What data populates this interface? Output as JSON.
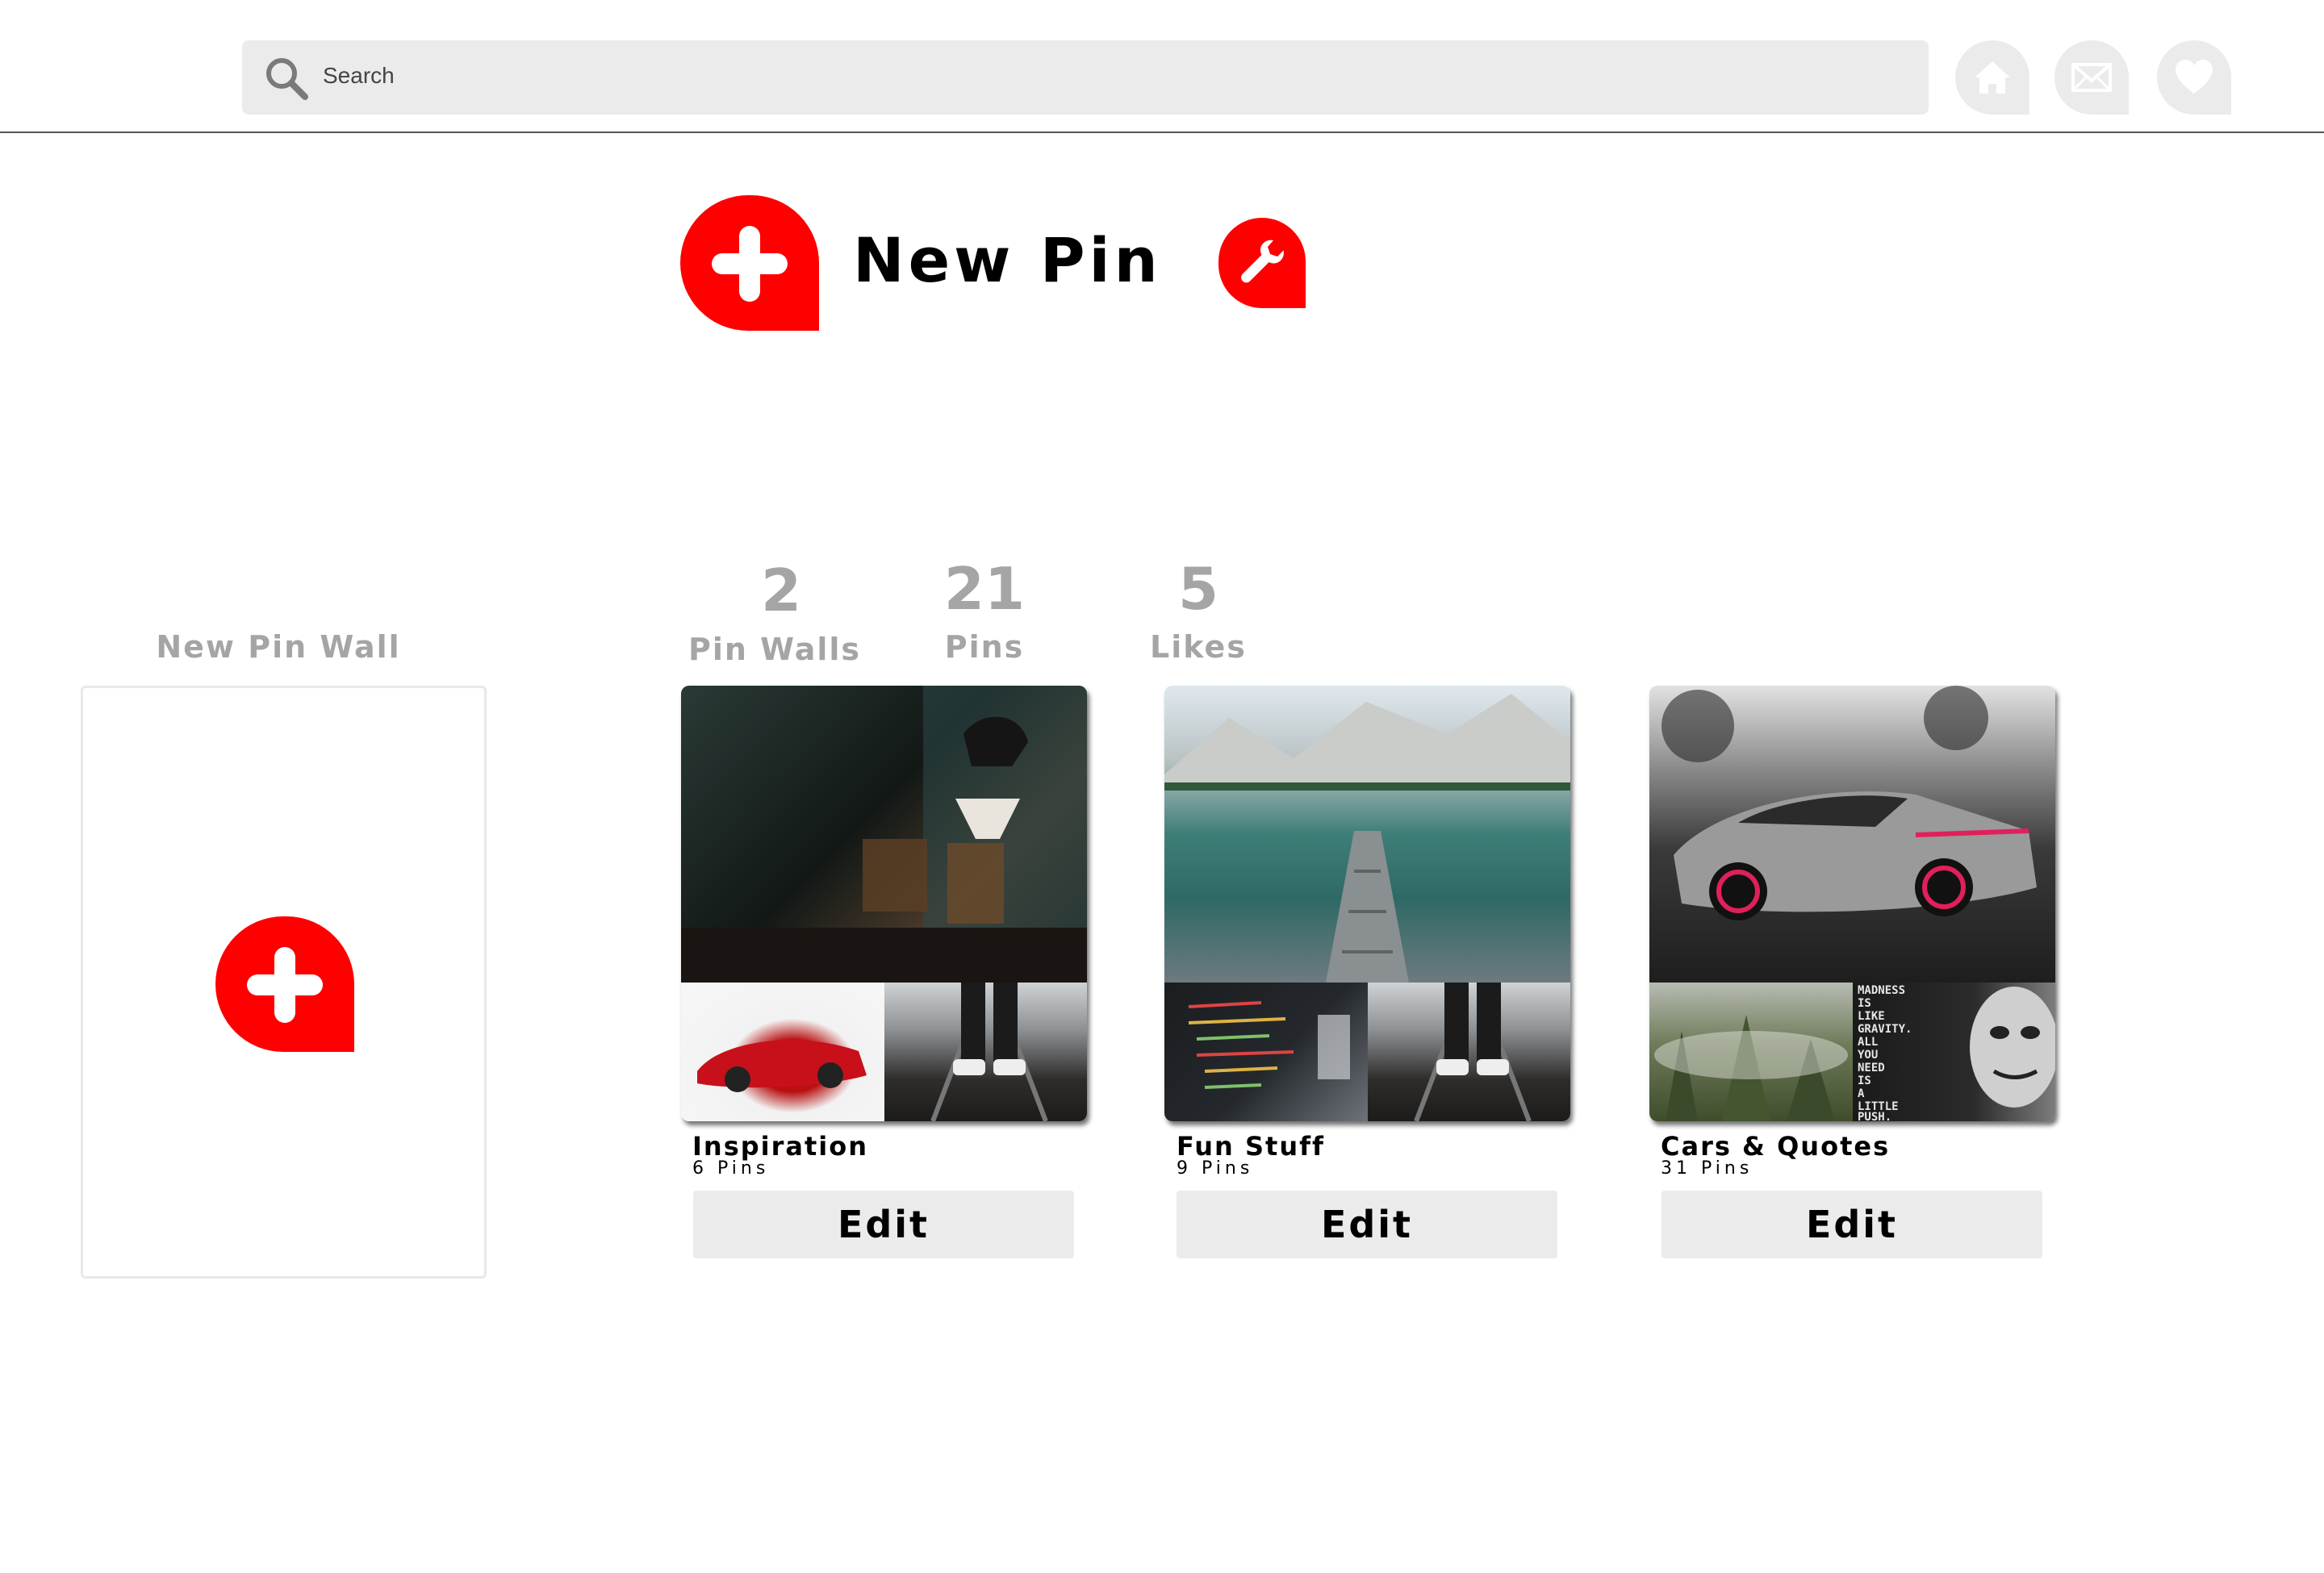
{
  "header": {
    "search_placeholder": "Search",
    "nav_icons": [
      "home-icon",
      "mail-icon",
      "heart-icon"
    ]
  },
  "new_pin": {
    "title": "New Pin",
    "accent_color": "#ff0000"
  },
  "stats": [
    {
      "value": "2",
      "label": "Pin Walls"
    },
    {
      "value": "21",
      "label": "Pins"
    },
    {
      "value": "5",
      "label": "Likes"
    }
  ],
  "new_pin_wall": {
    "label": "New Pin Wall"
  },
  "walls": [
    {
      "title": "Inspiration",
      "count": "6 Pins",
      "edit_label": "Edit"
    },
    {
      "title": "Fun Stuff",
      "count": "9 Pins",
      "edit_label": "Edit"
    },
    {
      "title": "Cars & Quotes",
      "count": "31 Pins",
      "edit_label": "Edit"
    }
  ],
  "quote_image_text": [
    "MADNESS",
    "IS",
    "LIKE",
    "GRAVITY.",
    "ALL",
    "YOU",
    "NEED",
    "IS",
    "A",
    "LITTLE",
    "PUSH."
  ]
}
